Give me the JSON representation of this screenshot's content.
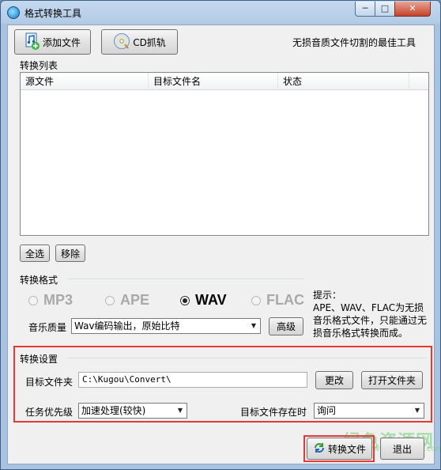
{
  "window": {
    "title": "格式转换工具",
    "controls": {
      "minimize": "─",
      "maximize": "□",
      "close": "✕"
    }
  },
  "toolbar": {
    "add_file_label": "添加文件",
    "cd_rip_label": "CD抓轨",
    "slogan": "无损音质文件切割的最佳工具"
  },
  "convert_list": {
    "title": "转换列表",
    "columns": [
      "源文件",
      "目标文件名",
      "状态"
    ],
    "select_all_label": "全选",
    "remove_label": "移除"
  },
  "format": {
    "title": "转换格式",
    "options": [
      "MP3",
      "APE",
      "WAV",
      "FLAC"
    ],
    "selected": "WAV",
    "quality_label": "音乐质量",
    "quality_value": "Wav编码输出，原始比特",
    "advanced_label": "高级",
    "hint_title": "提示：",
    "hint_text": "APE、WAV、FLAC为无损音乐格式文件，只能通过无损音乐格式转换而成。"
  },
  "settings": {
    "title": "转换设置",
    "target_folder_label": "目标文件夹",
    "target_folder_value": "C:\\Kugou\\Convert\\",
    "change_label": "更改",
    "open_folder_label": "打开文件夹",
    "priority_label": "任务优先级",
    "priority_value": "加速处理(较快)",
    "exists_label": "目标文件存在时",
    "exists_value": "询问"
  },
  "footer": {
    "convert_label": "转换文件",
    "exit_label": "退出"
  },
  "watermark": {
    "text": "绿色资源网",
    "sub": "www.downcc.com"
  },
  "colors": {
    "highlight": "#e53935",
    "accent": "#1a78c8"
  },
  "icons": {
    "add_file": "music-file-add-icon",
    "cd": "cd-icon",
    "convert": "convert-icon"
  }
}
